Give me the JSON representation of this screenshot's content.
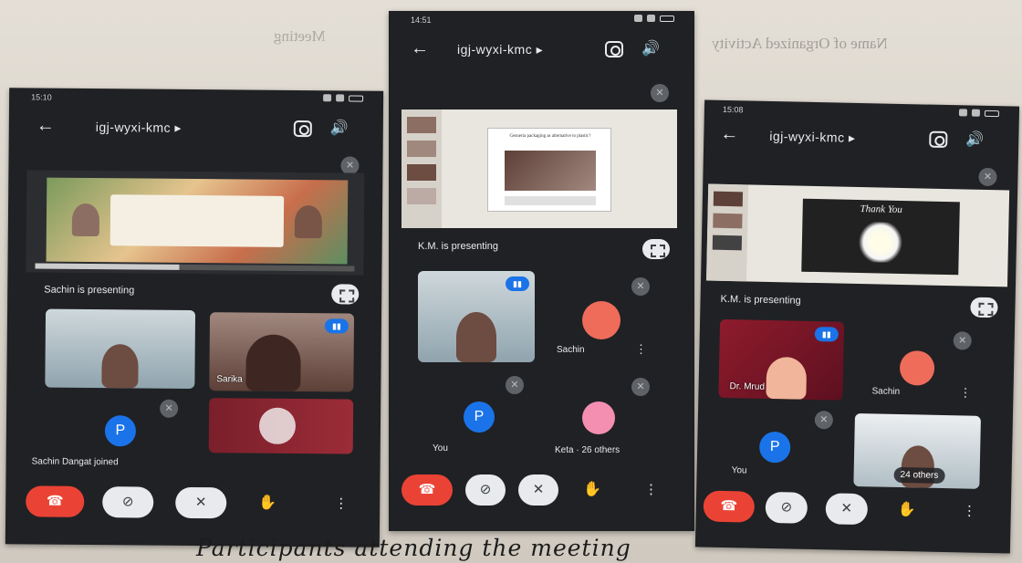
{
  "background": {
    "heading_fragment": "Name of Organized Activity",
    "heading_fragment_2": "Meeting",
    "caption": "Participants attending the meeting"
  },
  "colors": {
    "meet_dark": "#202124",
    "end_call": "#ea4335",
    "accent_blue": "#1a73e8"
  },
  "phones": [
    {
      "status_time": "15:10",
      "meeting_code": "igj-wyxi-kmc ▸",
      "presenting_label": "Sachin is presenting",
      "participants": [
        {
          "name": "Sarika"
        }
      ],
      "self_initial": "P",
      "toast": "Sachin Dangat joined",
      "controls": {
        "end_icon": "end-call-icon",
        "camera": "camera-off",
        "mic": "mic-off",
        "hand": "raise-hand",
        "more": "more"
      }
    },
    {
      "status_time": "14:51",
      "meeting_code": "igj-wyxi-kmc ▸",
      "presenting_label": "K.M. is presenting",
      "participants": [
        {
          "name": "Sachin"
        },
        {
          "name": "Keta · 26 others"
        }
      ],
      "self_label": "You",
      "self_initial": "P",
      "slide_title": "Gesneria packaging as alternative to plastic?"
    },
    {
      "status_time": "15:08",
      "meeting_code": "igj-wyxi-kmc ▸",
      "presenting_label": "K.M. is presenting",
      "participants": [
        {
          "name": "Dr. Mrud"
        },
        {
          "name": "Sachin"
        }
      ],
      "self_label": "You",
      "self_initial": "P",
      "others_pill": "24 others",
      "slide_text": "Thank You"
    }
  ]
}
